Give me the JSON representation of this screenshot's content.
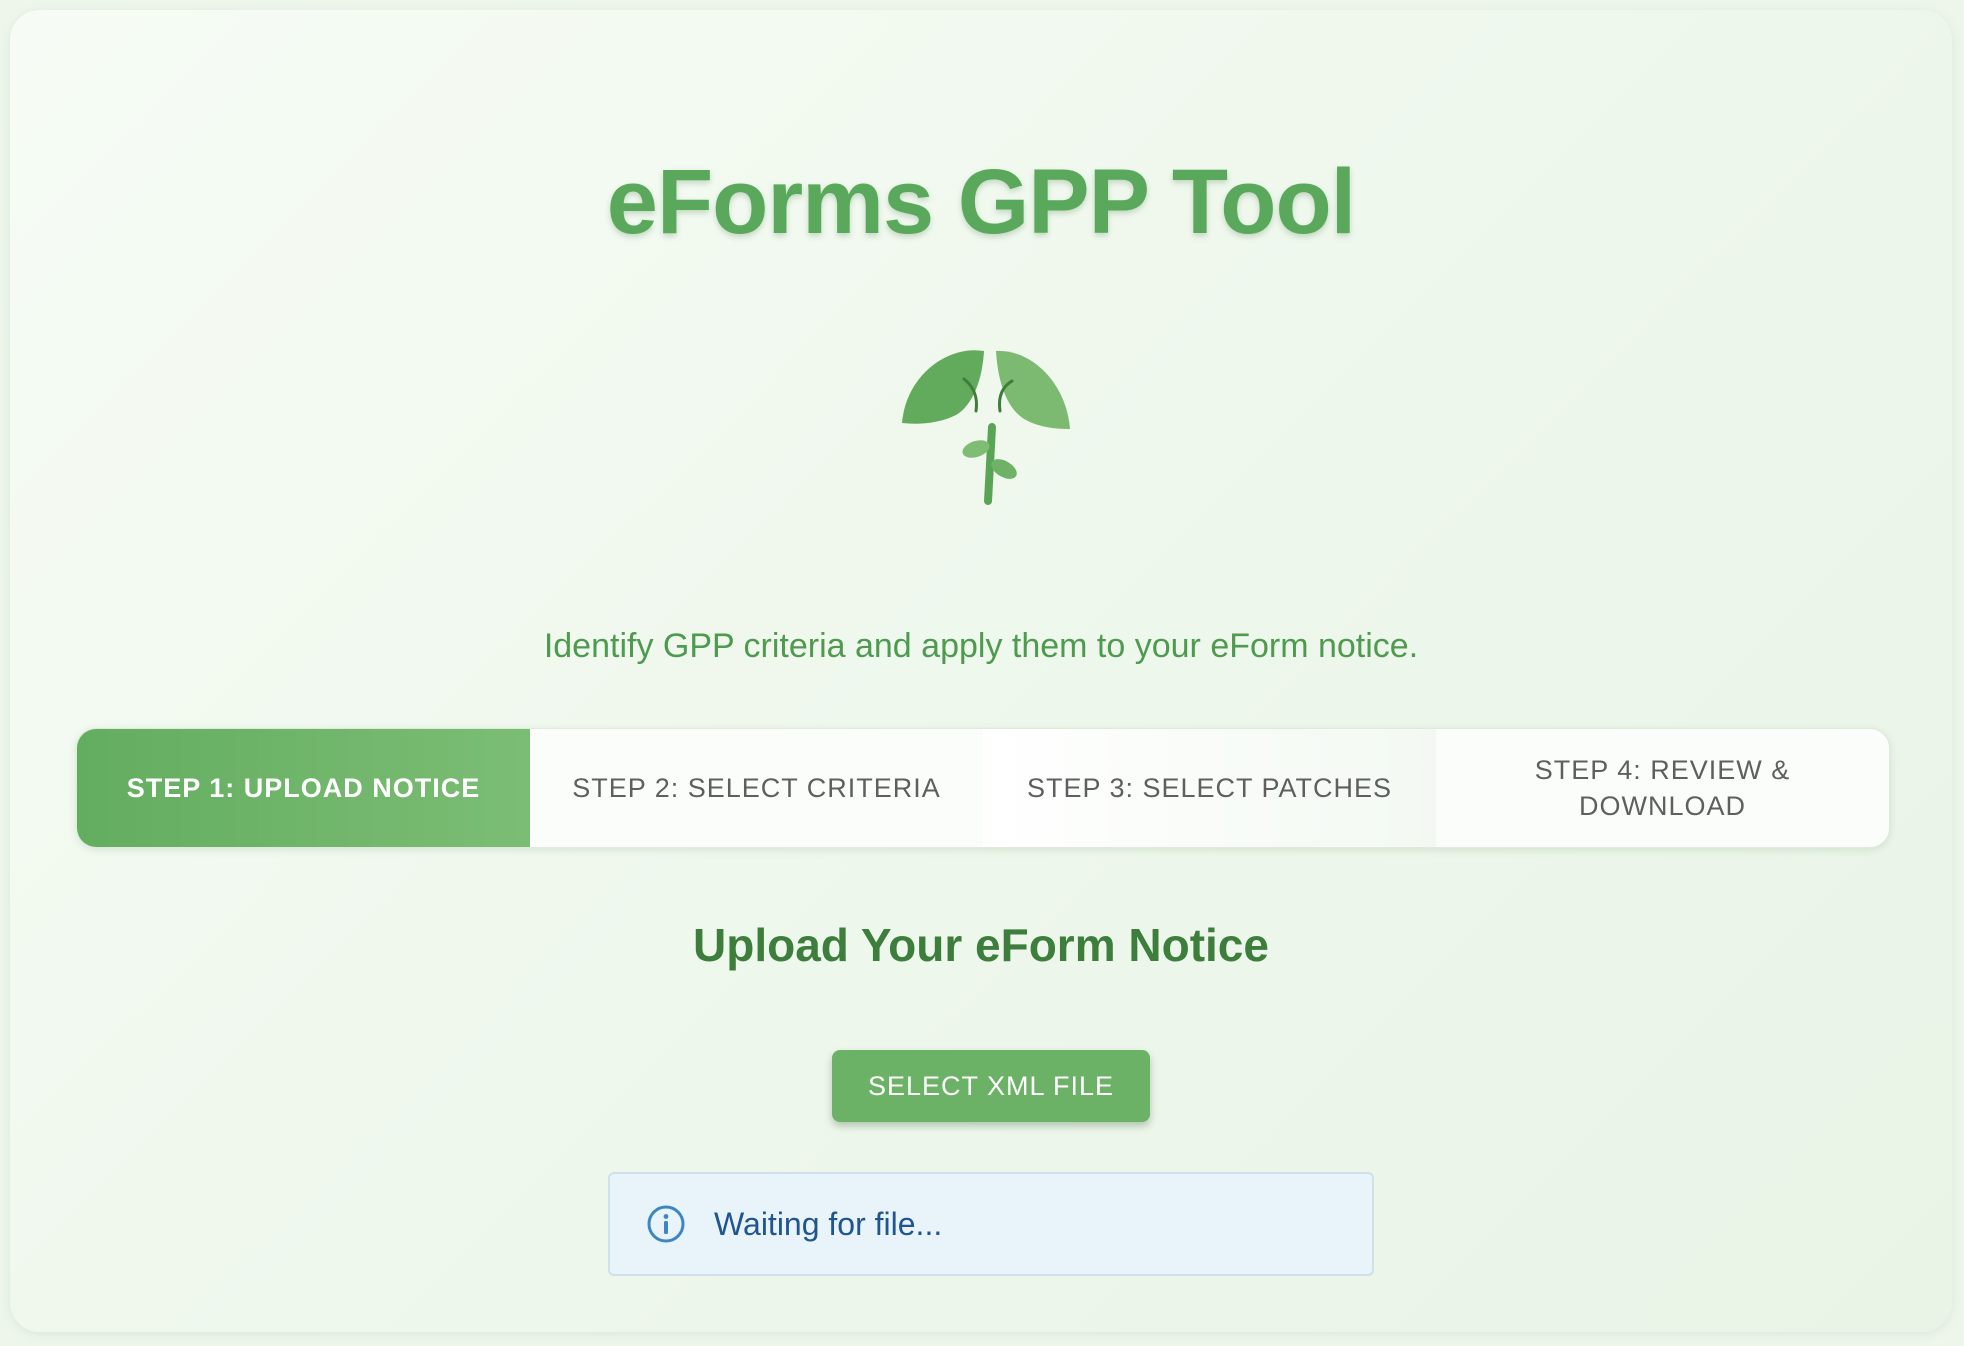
{
  "header": {
    "title": "eForms GPP Tool",
    "logo_icon": "sprout-logo-icon",
    "subtitle": "Identify GPP criteria and apply them to your eForm notice."
  },
  "stepper": {
    "active_index": 0,
    "steps": [
      {
        "label": "STEP 1: UPLOAD NOTICE"
      },
      {
        "label": "STEP 2: SELECT CRITERIA"
      },
      {
        "label": "STEP 3: SELECT PATCHES"
      },
      {
        "label": "STEP 4: REVIEW & DOWNLOAD"
      }
    ]
  },
  "main": {
    "section_title": "Upload Your eForm Notice",
    "select_button_label": "SELECT XML FILE",
    "status": {
      "icon": "info-icon",
      "text": "Waiting for file..."
    }
  },
  "colors": {
    "brand_green": "#5aa85b",
    "active_step": "#63ad60",
    "button": "#6cb266",
    "info_bg": "#e8f3fa",
    "info_text": "#21558f"
  }
}
